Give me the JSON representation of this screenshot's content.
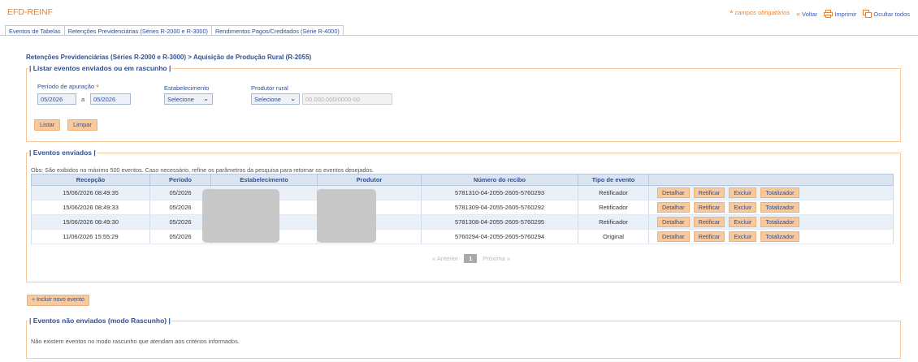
{
  "app": {
    "title": "EFD-REINF"
  },
  "top_links": {
    "required_note": "campos obrigatórios",
    "back": "Voltar",
    "print": "Imprimir",
    "hide_all": "Ocultar todos"
  },
  "tabs": [
    "Eventos de Tabelas",
    "Retenções Previdenciárias (Séries R-2000 e R-3000)",
    "Rendimentos Pagos/Creditados (Série R-4000)"
  ],
  "breadcrumb": "Retenções Previdenciárias (Séries R-2000 e R-3000) > Aquisição de Produção Rural (R-2055)",
  "filter": {
    "legend": "Listar eventos enviados ou em rascunho",
    "period_label": "Período de apuração",
    "period_from": "05/2026",
    "period_sep": "a",
    "period_to": "05/2026",
    "establishment_label": "Estabelecimento",
    "establishment_value": "Selecione",
    "producer_label": "Produtor rural",
    "producer_value": "Selecione",
    "producer_placeholder": "00.000.000/0000-00",
    "list_button": "Listar",
    "clear_button": "Limpar"
  },
  "sent": {
    "legend": "Eventos enviados",
    "obs": "Obs: São exibidos no máximo 500 eventos. Caso necessário, refine os parâmetros da pesquisa para retornar os eventos desejados.",
    "columns": [
      "Recepção",
      "Período",
      "Estabelecimento",
      "Produtor",
      "Número do recibo",
      "Tipo de evento",
      ""
    ],
    "rows": [
      {
        "reception": "15/06/2026 08:49:35",
        "period": "05/2026",
        "receipt": "5781310-04-2055-2605-5760293",
        "type": "Retificador"
      },
      {
        "reception": "15/06/2026 08:49:33",
        "period": "05/2026",
        "receipt": "5781309-04-2055-2605-5760292",
        "type": "Retificador"
      },
      {
        "reception": "15/06/2026 08:49:30",
        "period": "05/2026",
        "receipt": "5781308-04-2055-2605-5760295",
        "type": "Retificador"
      },
      {
        "reception": "11/06/2026 15:55:29",
        "period": "05/2026",
        "receipt": "5760294-04-2055-2605-5760294",
        "type": "Original"
      }
    ],
    "actions": [
      "Detalhar",
      "Retificar",
      "Excluir",
      "Totalizador"
    ],
    "pager": {
      "prev": "« Anterior",
      "current": "1",
      "next": "Próxima »"
    }
  },
  "include_button": "+ Incluir novo evento",
  "drafts": {
    "legend": "Eventos não enviados (modo Rascunho)",
    "empty": "Não existem eventos no modo rascunho que atendam aos critérios informados."
  },
  "colors": {
    "accent": "#f07f26",
    "link": "#2f4f8f",
    "button": "#f9c99e",
    "border": "#f5c99a",
    "header": "#dbe5f1"
  }
}
